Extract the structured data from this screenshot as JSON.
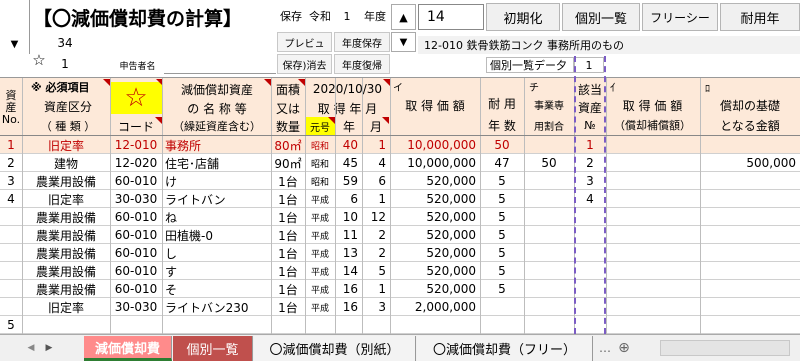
{
  "title": "【〇減価償却費の計算】",
  "header": {
    "hozon": "保存",
    "era": "令和",
    "year_value": "1",
    "year_label": "年度",
    "input_value": "14",
    "btn_init": "初期化",
    "btn_list": "個別一覧",
    "btn_free": "フリーシー",
    "btn_useful": "耐用年",
    "btn_preview": "プレビュ",
    "btn_year_save": "年度保存",
    "btn_save_erase": "保存)消去",
    "btn_year_restore": "年度復帰",
    "code_desc": "12-010 鉄骨鉄筋コンク 事務所用のもの",
    "list_data_label": "個別一覧デー夕",
    "list_data_value": "1",
    "row_number": "34",
    "row_sub": "1",
    "applicant_label": "申告者名",
    "star": "☆",
    "arrow_down": "▼",
    "arrow_up": "▲"
  },
  "columns": {
    "asset_no": "資\n産\nNo.",
    "required": "※ 必須項目",
    "star_big": "☆",
    "asset_class": "資産区分",
    "asset_class_sub": "（ 種 類 ）",
    "code": "コード",
    "asset_name": "減価償却資産",
    "asset_name2": "の 名 称 等",
    "asset_name3": "（繰延資産含む）",
    "area": "面積",
    "area2": "又は",
    "area3": "数量",
    "acq_date_top": "2020/10/30",
    "acq_date": "取 得 年 月",
    "era_col": "元号",
    "year_col": "年",
    "month_col": "月",
    "col_i": "イ",
    "acq_price": "取 得 価 額",
    "useful": "耐 用",
    "useful2": "年 数",
    "col_chi": "チ",
    "business": "事業専",
    "business2": "用割合",
    "applicable": "該当",
    "applicable2": "資産",
    "applicable3": "№",
    "col_i2": "ｲ",
    "acq_price2": "取 得 価 額",
    "acq_price2_sub": "（償却補償額）",
    "col_ro": "ﾛ",
    "base": "償却の基礎",
    "base2": "となる金額"
  },
  "rows": [
    {
      "no": "1",
      "class": "旧定率",
      "code": "12-010",
      "name": "事務所",
      "qty": "80㎡",
      "era": "昭和",
      "year": "40",
      "month": "1",
      "price": "10,000,000",
      "useful": "50",
      "ratio": "",
      "app": "1",
      "base": ""
    },
    {
      "no": "2",
      "class": "建物",
      "code": "12-020",
      "name": "住宅･店舗",
      "qty": "90㎡",
      "era": "昭和",
      "year": "45",
      "month": "4",
      "price": "10,000,000",
      "useful": "47",
      "ratio": "50",
      "app": "2",
      "base": "500,000"
    },
    {
      "no": "3",
      "class": "農業用設備",
      "code": "60-010",
      "name": "け",
      "qty": "1台",
      "era": "昭和",
      "year": "59",
      "month": "6",
      "price": "520,000",
      "useful": "5",
      "ratio": "",
      "app": "3",
      "base": ""
    },
    {
      "no": "4",
      "class": "旧定率",
      "code": "30-030",
      "name": "ライトバン",
      "qty": "1台",
      "era": "平成",
      "year": "6",
      "month": "1",
      "price": "520,000",
      "useful": "5",
      "ratio": "",
      "app": "4",
      "base": ""
    },
    {
      "no": "",
      "class": "農業用設備",
      "code": "60-010",
      "name": "ね",
      "qty": "1台",
      "era": "平成",
      "year": "10",
      "month": "12",
      "price": "520,000",
      "useful": "5",
      "ratio": "",
      "app": "",
      "base": ""
    },
    {
      "no": "",
      "class": "農業用設備",
      "code": "60-010",
      "name": "田植機-0",
      "qty": "1台",
      "era": "平成",
      "year": "11",
      "month": "2",
      "price": "520,000",
      "useful": "5",
      "ratio": "",
      "app": "",
      "base": ""
    },
    {
      "no": "",
      "class": "農業用設備",
      "code": "60-010",
      "name": "し",
      "qty": "1台",
      "era": "平成",
      "year": "13",
      "month": "2",
      "price": "520,000",
      "useful": "5",
      "ratio": "",
      "app": "",
      "base": ""
    },
    {
      "no": "",
      "class": "農業用設備",
      "code": "60-010",
      "name": "す",
      "qty": "1台",
      "era": "平成",
      "year": "14",
      "month": "5",
      "price": "520,000",
      "useful": "5",
      "ratio": "",
      "app": "",
      "base": ""
    },
    {
      "no": "",
      "class": "農業用設備",
      "code": "60-010",
      "name": "そ",
      "qty": "1台",
      "era": "平成",
      "year": "16",
      "month": "1",
      "price": "520,000",
      "useful": "5",
      "ratio": "",
      "app": "",
      "base": ""
    },
    {
      "no": "",
      "class": "旧定率",
      "code": "30-030",
      "name": "ライトバン230",
      "qty": "1台",
      "era": "平成",
      "year": "16",
      "month": "3",
      "price": "2,000,000",
      "useful": "",
      "ratio": "",
      "app": "",
      "base": ""
    },
    {
      "no": "5",
      "class": "",
      "code": "",
      "name": "",
      "qty": "",
      "era": "",
      "year": "",
      "month": "",
      "price": "",
      "useful": "",
      "ratio": "",
      "app": "",
      "base": ""
    }
  ],
  "tabs": [
    {
      "label": "減価償却費"
    },
    {
      "label": "個別一覧"
    },
    {
      "label": "〇減価償却費（別紙）"
    },
    {
      "label": "〇減価償却費（フリー）"
    }
  ],
  "sheet_nav_prev": "◀",
  "sheet_nav_next": "▶",
  "tab_more": "…",
  "tab_add": "⊕",
  "colors": {
    "header_peach": "#fde9d9",
    "row1_text": "#c00000",
    "tab_red": "#ff7f7f",
    "tab_brown": "#c0504d"
  }
}
